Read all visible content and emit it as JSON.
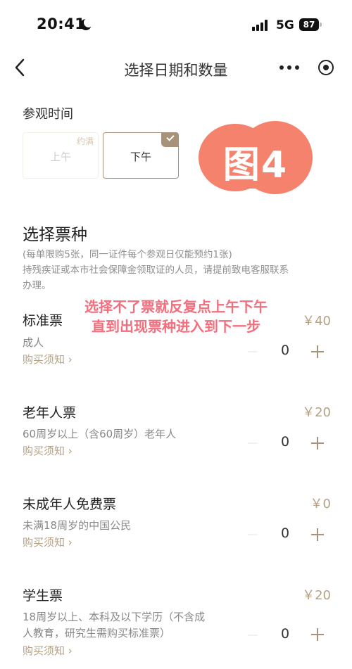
{
  "status_bar": {
    "time": "20:41",
    "network": "5G",
    "battery": "87"
  },
  "nav": {
    "title": "选择日期和数量"
  },
  "visit_time": {
    "label": "参观时间",
    "slots": [
      {
        "label": "上午",
        "badge": "约满"
      },
      {
        "label": "下午"
      }
    ],
    "selected_slot": "下午"
  },
  "sticker": {
    "text": "图4"
  },
  "ticket_section": {
    "title": "选择票种",
    "notes": [
      "(每单限购5张，同一证件每个参观日仅能预约1张)",
      "持残疾证或本市社会保障金领取证的人员，请提前致电客服联系",
      "办理。"
    ]
  },
  "overlay": {
    "line1": "选择不了票就反复点上午下午",
    "line2": "直到出现票种进入到下一步"
  },
  "tickets": [
    {
      "name": "标准票",
      "price": "￥40",
      "desc1": "成人",
      "desc2": "",
      "link": "购买须知",
      "qty": "0"
    },
    {
      "name": "老年人票",
      "price": "￥20",
      "desc1": "60周岁以上（含60周岁）老年人",
      "desc2": "",
      "link": "购买须知",
      "qty": "0"
    },
    {
      "name": "未成年人免费票",
      "price": "￥0",
      "desc1": "未满18周岁的中国公民",
      "desc2": "",
      "link": "购买须知",
      "qty": "0"
    },
    {
      "name": "学生票",
      "price": "￥20",
      "desc1": "18周岁以上、本科及以下学历（不含成",
      "desc2": "人教育，研究生需购买标准票）",
      "link": "购买须知",
      "qty": "0"
    }
  ],
  "link_arrow": "›"
}
